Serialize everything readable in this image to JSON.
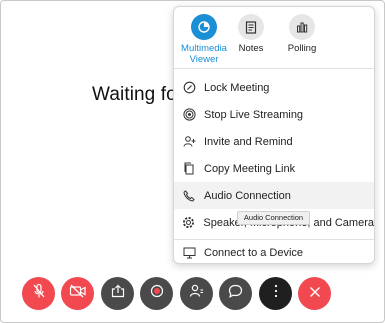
{
  "waiting_text": "Waiting for c",
  "menu": {
    "top_buttons": [
      {
        "label": "Multimedia\nViewer",
        "icon": "multimedia-viewer-icon",
        "active": true
      },
      {
        "label": "Notes",
        "icon": "notes-icon",
        "active": false
      },
      {
        "label": "Polling",
        "icon": "polling-icon",
        "active": false
      }
    ],
    "items": [
      {
        "label": "Lock Meeting",
        "icon": "lock-icon"
      },
      {
        "label": "Stop Live Streaming",
        "icon": "live-streaming-icon"
      },
      {
        "label": "Invite and Remind",
        "icon": "invite-icon"
      },
      {
        "label": "Copy Meeting Link",
        "icon": "copy-icon"
      },
      {
        "label": "Audio Connection",
        "icon": "phone-icon"
      },
      {
        "label": "Speaker, Microphone, and Camera",
        "icon": "settings-gear-icon"
      },
      {
        "label": "Connect to a Device",
        "icon": "device-icon"
      }
    ]
  },
  "tooltip": "Audio Connection",
  "toolbar": [
    {
      "name": "mute-button",
      "icon": "microphone-muted-icon",
      "color": "#f2484f"
    },
    {
      "name": "video-button",
      "icon": "video-off-icon",
      "color": "#f2484f"
    },
    {
      "name": "share-button",
      "icon": "share-icon",
      "color": "#4a4a4a"
    },
    {
      "name": "record-button",
      "icon": "record-icon",
      "color": "#4a4a4a"
    },
    {
      "name": "participants-button",
      "icon": "participants-icon",
      "color": "#4a4a4a"
    },
    {
      "name": "chat-button",
      "icon": "chat-icon",
      "color": "#4a4a4a"
    },
    {
      "name": "more-button",
      "icon": "more-options-icon",
      "color": "#1f1f1f"
    },
    {
      "name": "end-meeting-button",
      "icon": "close-icon",
      "color": "#f2484f"
    }
  ]
}
